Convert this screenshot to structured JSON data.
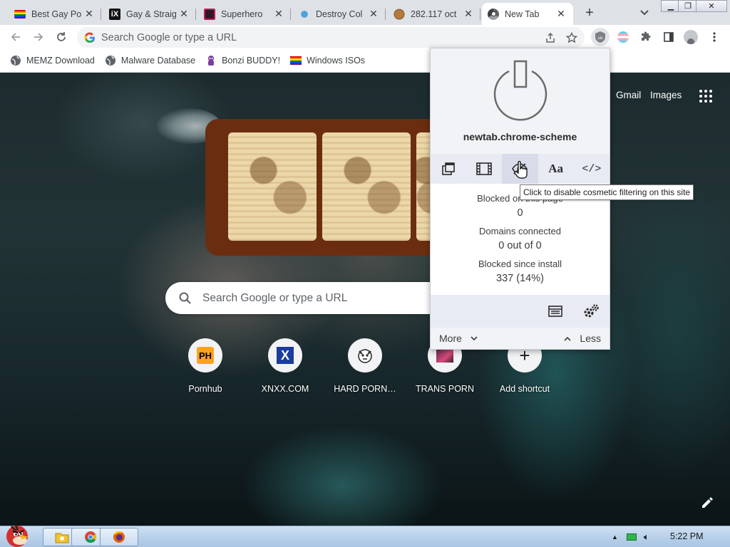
{
  "tabs": [
    {
      "title": "Best Gay Po",
      "favicon": "rainbow-flag-icon"
    },
    {
      "title": "Gay & Straig",
      "favicon": "ix-logo-icon"
    },
    {
      "title": "Superhero",
      "favicon": "superhero-site-icon"
    },
    {
      "title": "Destroy Col",
      "favicon": "destroy-site-icon"
    },
    {
      "title": "282.117 oct",
      "favicon": "cookie-site-icon"
    },
    {
      "title": "New Tab",
      "favicon": "chrome-icon",
      "active": true
    }
  ],
  "omnibox": {
    "placeholder": "Search Google or type a URL"
  },
  "bookmarks": [
    {
      "label": "MEMZ Download",
      "icon": "globe-icon"
    },
    {
      "label": "Malware Database",
      "icon": "globe-icon"
    },
    {
      "label": "Bonzi BUDDY!",
      "icon": "bonzi-icon"
    },
    {
      "label": "Windows ISOs",
      "icon": "rainbow-flag-icon"
    }
  ],
  "page": {
    "gmail": "Gmail",
    "images": "Images",
    "search_placeholder": "Search Google or type a URL"
  },
  "shortcuts": [
    {
      "label": "Pornhub",
      "icon": "ph-icon",
      "glyph": "PH"
    },
    {
      "label": "XNXX.COM",
      "icon": "x-icon",
      "glyph": "X"
    },
    {
      "label": "HARD PORN…",
      "icon": "animal-icon"
    },
    {
      "label": "TRANS PORN",
      "icon": "trans-site-icon"
    },
    {
      "label": "Add shortcut",
      "icon": "plus-icon",
      "glyph": "+"
    }
  ],
  "ublock": {
    "hostname": "newtab.chrome-scheme",
    "tools": [
      "popup-blocking-icon",
      "media-blocking-icon",
      "cosmetic-filtering-icon",
      "fonts-icon",
      "javascript-icon"
    ],
    "fonts_glyph": "Aa",
    "javascript_glyph": "</>",
    "tooltip": "Click to disable cosmetic filtering on this site",
    "blocked_page_label": "Blocked on this page",
    "blocked_page_value": "0",
    "domains_label": "Domains connected",
    "domains_value": "0 out of 0",
    "blocked_install_label": "Blocked since install",
    "blocked_install_value": "337 (14%)",
    "more": "More",
    "less": "Less"
  },
  "taskbar": {
    "clock": "5:22 PM"
  }
}
